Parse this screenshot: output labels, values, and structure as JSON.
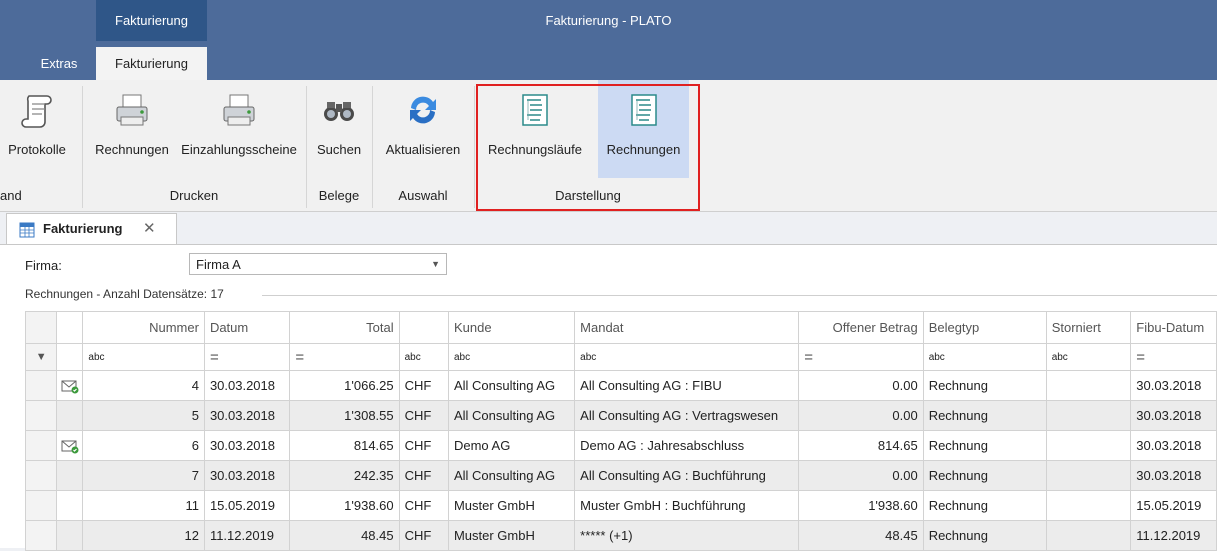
{
  "window": {
    "context_tab": "Fakturierung",
    "title": "Fakturierung - PLATO"
  },
  "ribbon_tabs": [
    {
      "label": "Extras"
    },
    {
      "label": "Fakturierung"
    }
  ],
  "ribbon": {
    "buttons": {
      "protokolle": "Protokolle",
      "rechnungen_print": "Rechnungen",
      "einzahlungsscheine": "Einzahlungsscheine",
      "suchen": "Suchen",
      "aktualisieren": "Aktualisieren",
      "rechnungslaeufe": "Rechnungsläufe",
      "rechnungen_view": "Rechnungen"
    },
    "groups": {
      "partial": "and",
      "drucken": "Drucken",
      "belege": "Belege",
      "auswahl": "Auswahl",
      "darstellung": "Darstellung"
    }
  },
  "document_tab": {
    "label": "Fakturierung",
    "close": "✕"
  },
  "filter": {
    "firma_label": "Firma:",
    "firma_value": "Firma A"
  },
  "grid_caption": "Rechnungen - Anzahl Datensätze: 17",
  "grid": {
    "columns": [
      "Nummer",
      "Datum",
      "Total",
      "",
      "Kunde",
      "Mandat",
      "Offener Betrag",
      "Belegtyp",
      "Storniert",
      "Fibu-Datum"
    ],
    "filter_row": [
      "abc",
      "=",
      "=",
      "abc",
      "abc",
      "abc",
      "=",
      "abc",
      "abc",
      "="
    ],
    "rows": [
      {
        "nummer": "4",
        "datum": "30.03.2018",
        "total": "1'066.25",
        "waehrung": "CHF",
        "kunde": "All Consulting AG",
        "mandat": "All Consulting AG : FIBU",
        "offen": "0.00",
        "belegtyp": "Rechnung",
        "storniert": "",
        "fibu": "30.03.2018",
        "icon": true
      },
      {
        "nummer": "5",
        "datum": "30.03.2018",
        "total": "1'308.55",
        "waehrung": "CHF",
        "kunde": "All Consulting AG",
        "mandat": "All Consulting AG : Vertragswesen",
        "offen": "0.00",
        "belegtyp": "Rechnung",
        "storniert": "",
        "fibu": "30.03.2018",
        "icon": false
      },
      {
        "nummer": "6",
        "datum": "30.03.2018",
        "total": "814.65",
        "waehrung": "CHF",
        "kunde": "Demo AG",
        "mandat": "Demo AG : Jahresabschluss",
        "offen": "814.65",
        "belegtyp": "Rechnung",
        "storniert": "",
        "fibu": "30.03.2018",
        "icon": true
      },
      {
        "nummer": "7",
        "datum": "30.03.2018",
        "total": "242.35",
        "waehrung": "CHF",
        "kunde": "All Consulting AG",
        "mandat": "All Consulting AG : Buchführung",
        "offen": "0.00",
        "belegtyp": "Rechnung",
        "storniert": "",
        "fibu": "30.03.2018",
        "icon": false
      },
      {
        "nummer": "11",
        "datum": "15.05.2019",
        "total": "1'938.60",
        "waehrung": "CHF",
        "kunde": "Muster GmbH",
        "mandat": "Muster GmbH : Buchführung",
        "offen": "1'938.60",
        "belegtyp": "Rechnung",
        "storniert": "",
        "fibu": "15.05.2019",
        "icon": false
      },
      {
        "nummer": "12",
        "datum": "11.12.2019",
        "total": "48.45",
        "waehrung": "CHF",
        "kunde": "Muster GmbH",
        "mandat": "***** (+1)",
        "offen": "48.45",
        "belegtyp": "Rechnung",
        "storniert": "",
        "fibu": "11.12.2019",
        "icon": false
      }
    ]
  },
  "colors": {
    "titlebar": "#4d6b9a",
    "context_tab": "#2f5688",
    "ribbon": "#f1f1f1",
    "active_button": "#ccdaf3",
    "highlight": "#e02020"
  }
}
